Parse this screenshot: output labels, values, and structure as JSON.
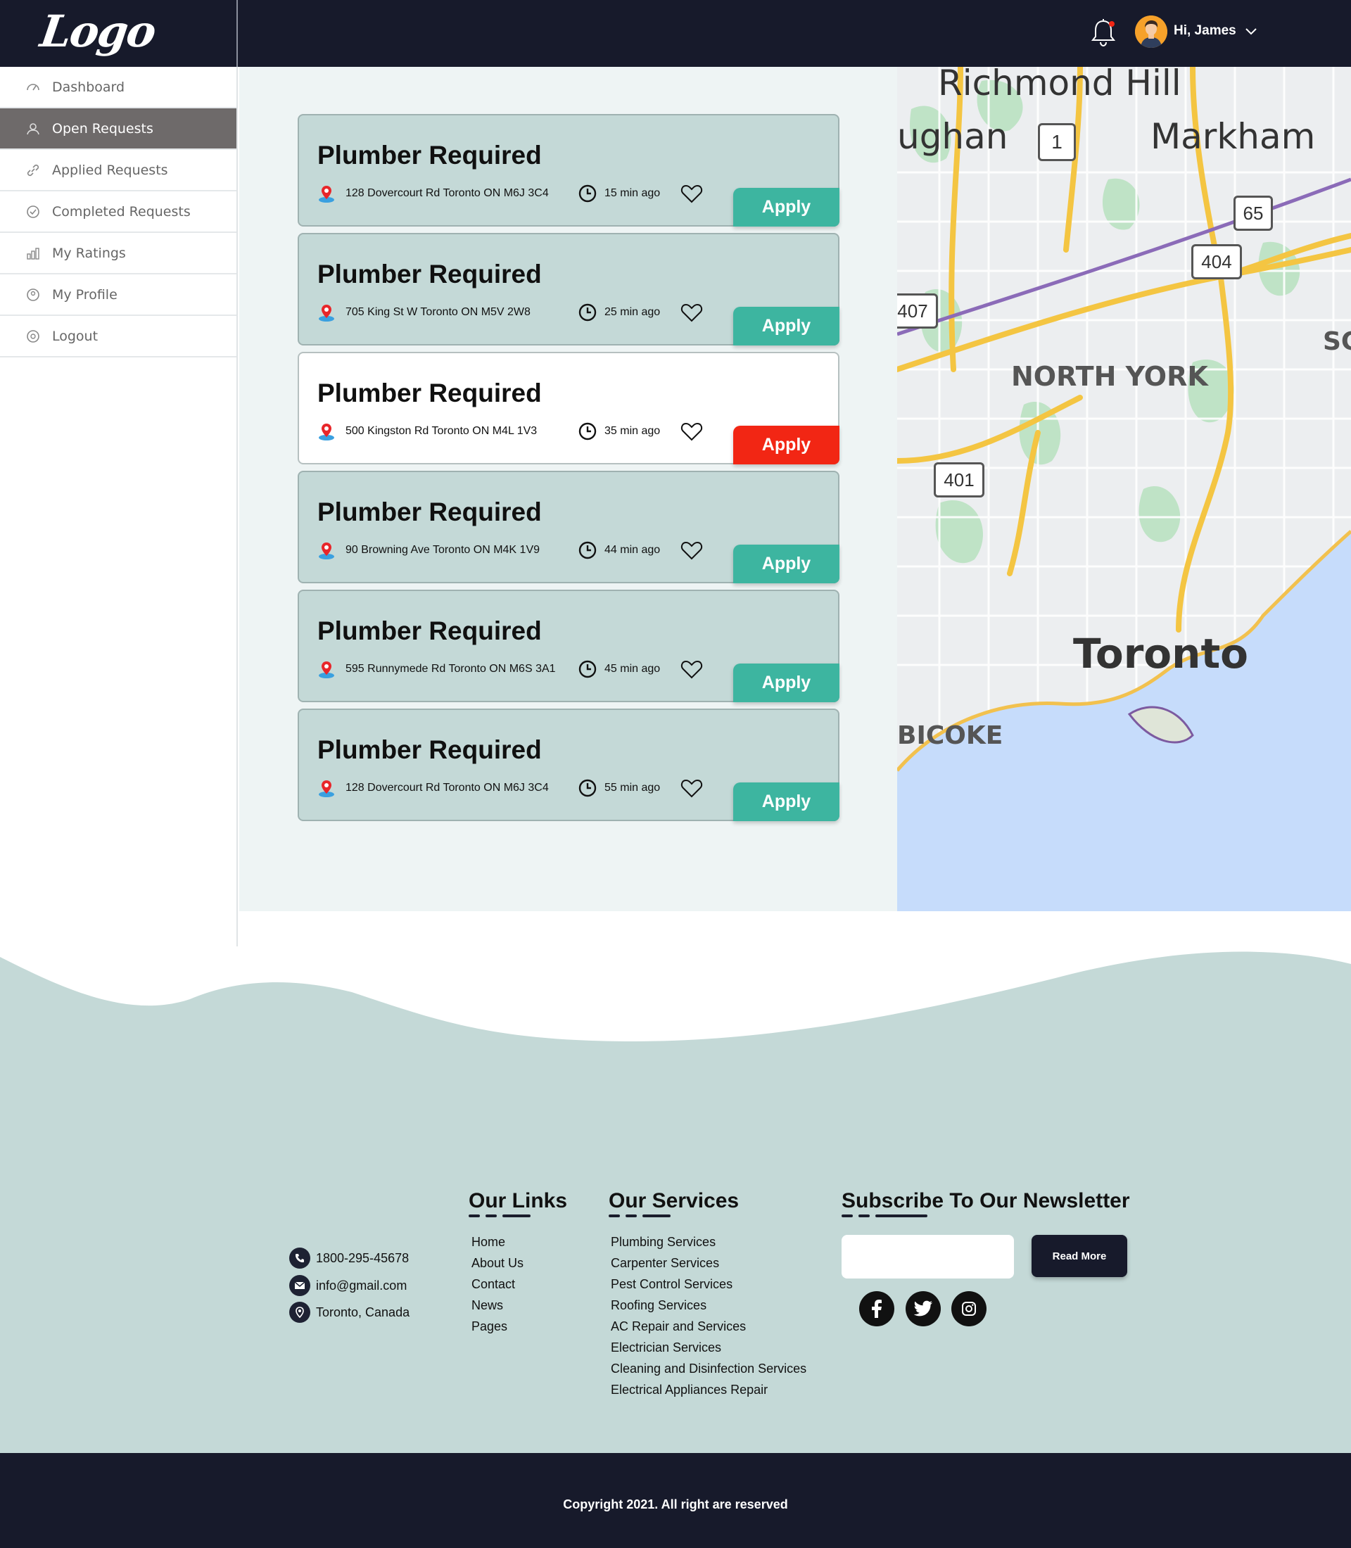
{
  "header": {
    "logo": "Logo",
    "greeting": "Hi, James"
  },
  "sidebar": {
    "items": [
      {
        "label": "Dashboard",
        "icon": "dashboard-icon",
        "active": false
      },
      {
        "label": "Open Requests",
        "icon": "requests-icon",
        "active": true
      },
      {
        "label": "Applied Requests",
        "icon": "link-icon",
        "active": false
      },
      {
        "label": "Completed Requests",
        "icon": "check-icon",
        "active": false
      },
      {
        "label": "My Ratings",
        "icon": "ratings-icon",
        "active": false
      },
      {
        "label": "My Profile",
        "icon": "profile-icon",
        "active": false
      },
      {
        "label": "Logout",
        "icon": "logout-icon",
        "active": false
      }
    ]
  },
  "requests": [
    {
      "title": "Plumber Required",
      "address": "128 Dovercourt Rd Toronto ON M6J 3C4",
      "time": "15 min ago",
      "apply": "Apply",
      "highlighted": false
    },
    {
      "title": "Plumber Required",
      "address": "705 King St W Toronto ON M5V 2W8",
      "time": "25 min ago",
      "apply": "Apply",
      "highlighted": false
    },
    {
      "title": "Plumber Required",
      "address": "500 Kingston Rd Toronto ON M4L 1V3",
      "time": "35 min ago",
      "apply": "Apply",
      "highlighted": true
    },
    {
      "title": "Plumber Required",
      "address": "90 Browning Ave Toronto ON M4K 1V9",
      "time": "44 min ago",
      "apply": "Apply",
      "highlighted": false
    },
    {
      "title": "Plumber Required",
      "address": "595 Runnymede Rd Toronto ON M6S 3A1",
      "time": "45 min ago",
      "apply": "Apply",
      "highlighted": false
    },
    {
      "title": "Plumber Required",
      "address": "128 Dovercourt Rd Toronto ON M6J 3C4",
      "time": "55 min ago",
      "apply": "Apply",
      "highlighted": false
    }
  ],
  "map": {
    "labels": [
      "Richmond Hill",
      "ughan",
      "Markham",
      "NORTH YORK",
      "Toronto",
      "BICOKE",
      "SC"
    ],
    "shields": [
      "1",
      "65",
      "404",
      "407",
      "401"
    ]
  },
  "footer": {
    "contact": {
      "phone": "1800-295-45678",
      "email": "info@gmail.com",
      "location": "Toronto, Canada"
    },
    "links_title": "Our Links",
    "links": [
      "Home",
      "About Us",
      "Contact",
      "News",
      "Pages"
    ],
    "services_title": "Our Services",
    "services": [
      "Plumbing Services",
      "Carpenter Services",
      "Pest Control Services",
      "Roofing Services",
      "AC Repair and Services",
      "Electrician Services",
      "Cleaning and Disinfection Services",
      "Electrical Appliances Repair"
    ],
    "newsletter_title": "Subscribe To Our Newsletter",
    "newsletter_input_value": "",
    "newsletter_button": "Read More",
    "socials": [
      "facebook-icon",
      "twitter-icon",
      "instagram-icon"
    ],
    "copyright": "Copyright 2021. All right are reserved"
  },
  "colors": {
    "header_bg": "#171a2b",
    "card_bg": "#c4d9d7",
    "apply_teal": "#3db5a0",
    "apply_red": "#f22614",
    "sidebar_active": "#6e6a6a",
    "footer_bg": "#c4d9d7"
  }
}
